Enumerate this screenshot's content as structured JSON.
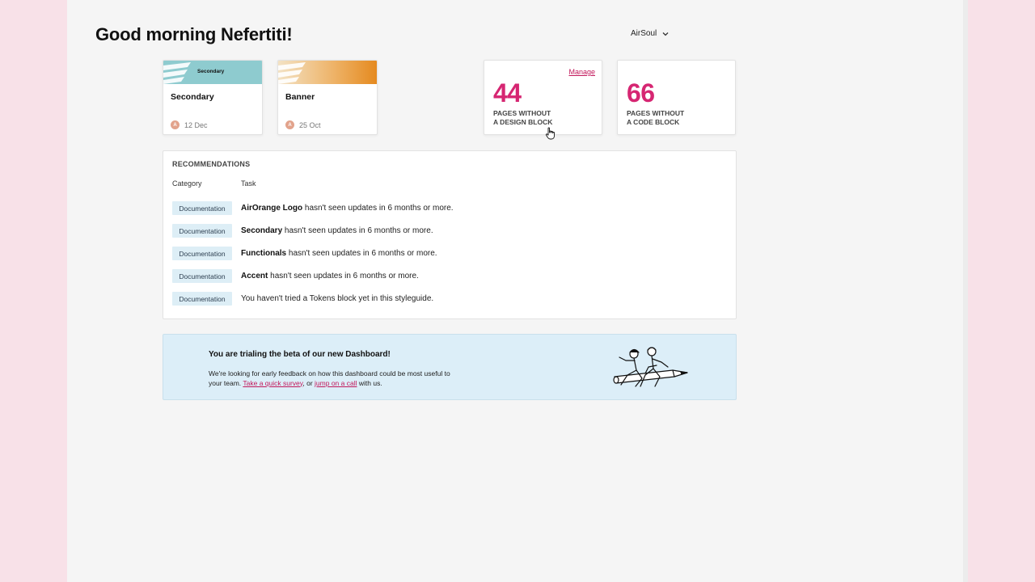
{
  "greeting": "Good morning Nefertiti!",
  "workspace": {
    "name": "AirSoul",
    "icon": "chevron-down-icon"
  },
  "recent_cards": [
    {
      "thumb_label": "Secondary",
      "title": "Secondary",
      "avatar": "A",
      "date": "12 Dec",
      "thumb_color": "#8ecbcf"
    },
    {
      "thumb_label": "",
      "title": "Banner",
      "avatar": "A",
      "date": "25 Oct",
      "thumb_color": "#e58a1f"
    }
  ],
  "stats": [
    {
      "number": "44",
      "label_line1": "PAGES WITHOUT",
      "label_line2": "A DESIGN BLOCK",
      "action": "Manage"
    },
    {
      "number": "66",
      "label_line1": "PAGES WITHOUT",
      "label_line2": "A CODE BLOCK"
    }
  ],
  "recommendations": {
    "title": "RECOMMENDATIONS",
    "columns": {
      "category": "Category",
      "task": "Task"
    },
    "rows": [
      {
        "category": "Documentation",
        "bold": "AirOrange Logo",
        "rest": " hasn't seen updates in 6 months or more."
      },
      {
        "category": "Documentation",
        "bold": "Secondary",
        "rest": " hasn't seen updates in 6 months or more."
      },
      {
        "category": "Documentation",
        "bold": "Functionals",
        "rest": " hasn't seen updates in 6 months or more."
      },
      {
        "category": "Documentation",
        "bold": "Accent",
        "rest": " hasn't seen updates in 6 months or more."
      },
      {
        "category": "Documentation",
        "bold": "",
        "rest": "You haven't tried a Tokens block yet in this styleguide."
      }
    ]
  },
  "beta_banner": {
    "title": "You are trialing the beta of our new Dashboard!",
    "text_before": "We're looking for early feedback on how this dashboard could be most useful to your team. ",
    "link1": "Take a quick survey",
    "text_middle": ", or ",
    "link2": "jump on a call",
    "text_after": " with us."
  },
  "colors": {
    "accent": "#d62672",
    "badge_bg": "#ddeef6",
    "banner_bg": "#dceef8"
  }
}
